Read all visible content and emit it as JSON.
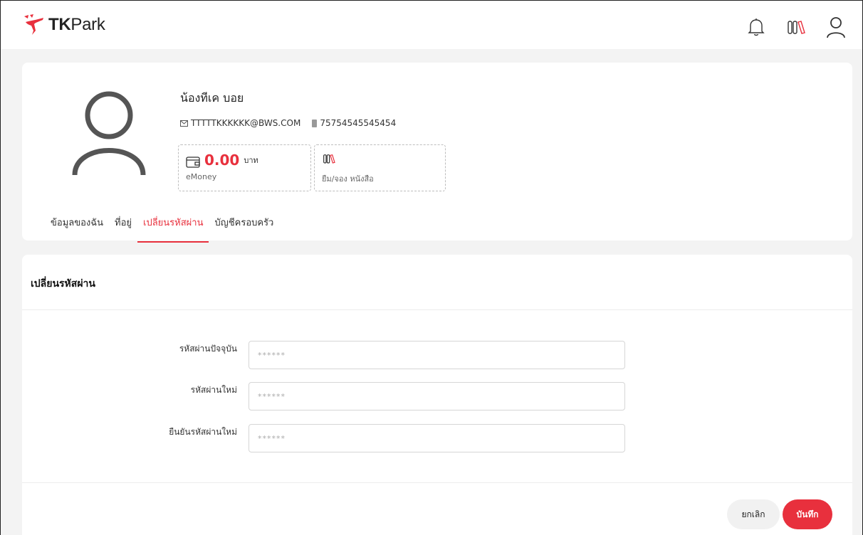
{
  "header": {
    "logo_text": "TKPark",
    "icons": [
      "bell-icon",
      "books-icon",
      "user-icon"
    ]
  },
  "profile": {
    "name": "น้องทีเค บอย",
    "email": "TTTTTKKKKKK@BWS.COM",
    "card_number": "75754545545454",
    "emoney": {
      "value": "0.00",
      "unit": "บาท",
      "label": "eMoney"
    },
    "borrow": {
      "label": "ยืม/จอง หนังสือ"
    },
    "tabs": [
      {
        "label": "ข้อมูลของฉัน",
        "active": false
      },
      {
        "label": "ที่อยู่",
        "active": false
      },
      {
        "label": "เปลี่ยนรหัสผ่าน",
        "active": true
      },
      {
        "label": "บัญชีครอบครัว",
        "active": false
      }
    ]
  },
  "password_form": {
    "title": "เปลี่ยนรหัสผ่าน",
    "current": {
      "label": "รหัสผ่านปัจจุบัน",
      "placeholder": "******"
    },
    "new": {
      "label": "รหัสผ่านใหม่",
      "placeholder": "******"
    },
    "confirm": {
      "label": "ยืนยันรหัสผ่านใหม่",
      "placeholder": "******"
    },
    "cancel_label": "ยกเลิก",
    "save_label": "บันทึก"
  },
  "colors": {
    "accent": "#e8303d",
    "background": "#f3f3f3"
  }
}
